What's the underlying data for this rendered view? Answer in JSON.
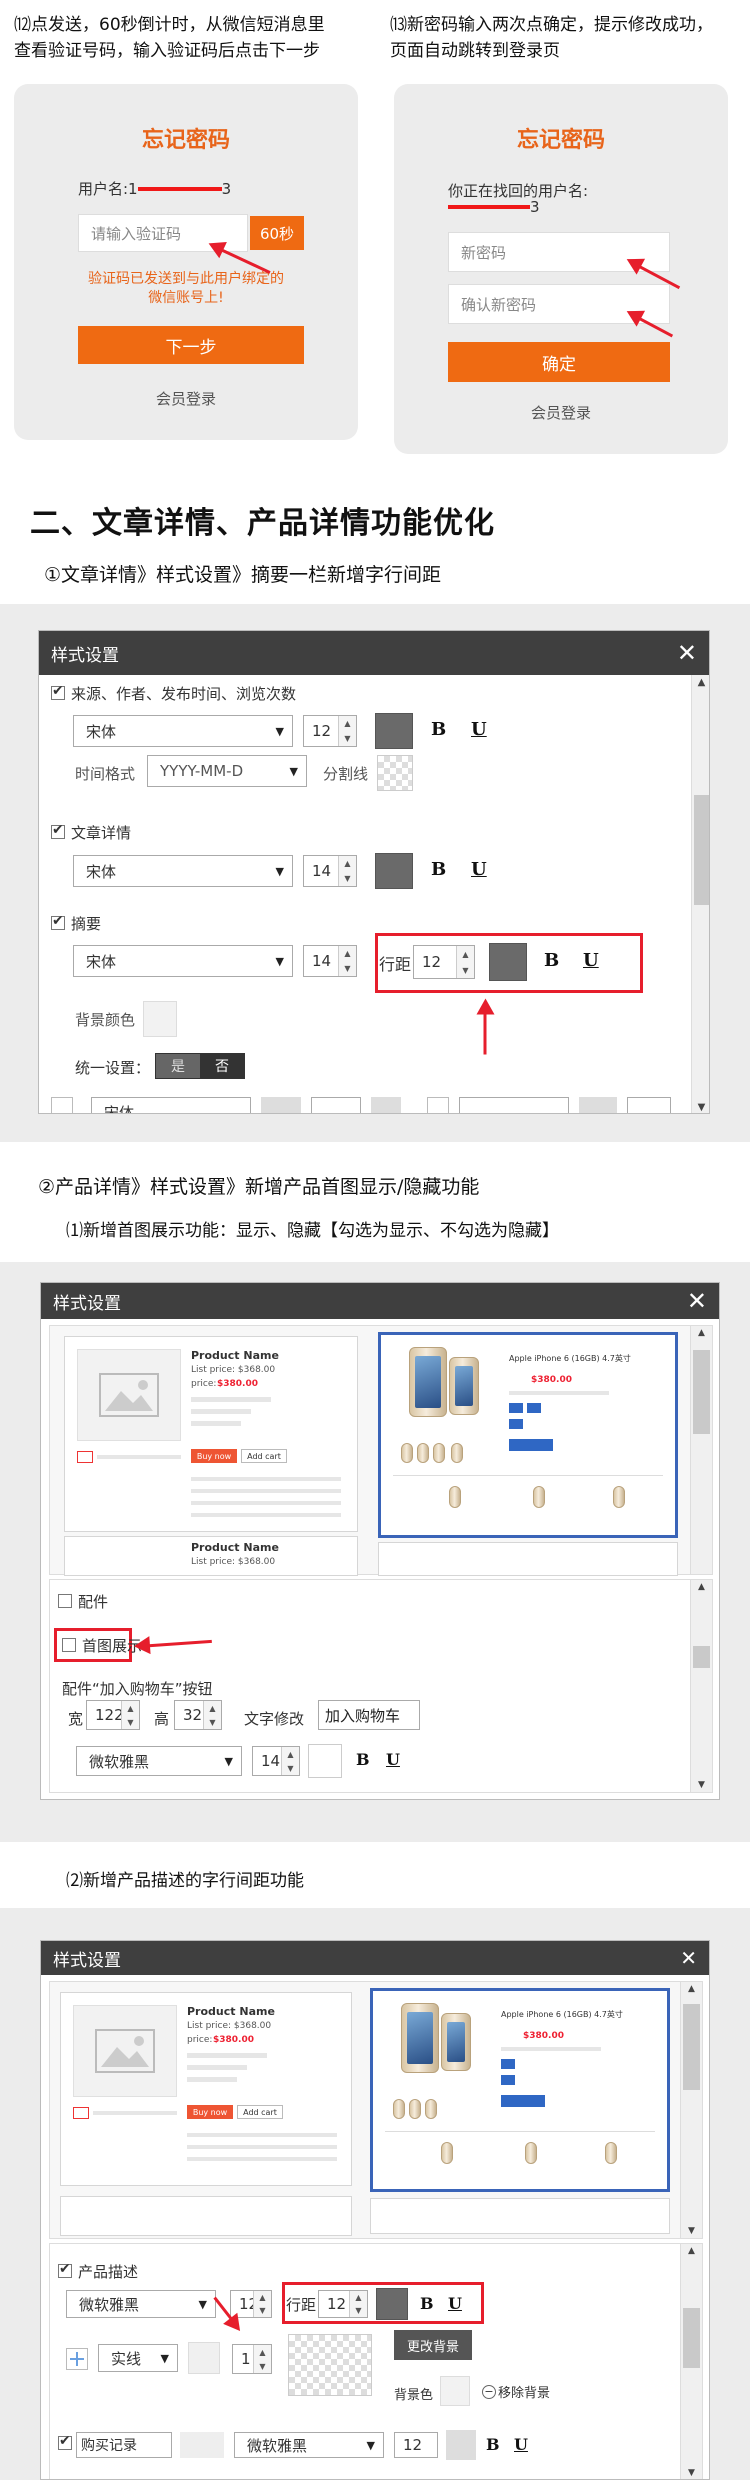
{
  "steps": {
    "step12": {
      "line1": "⑿点发送，60秒倒计时，从微信短消息里",
      "line2": "查看验证号码，输入验证码后点击下一步"
    },
    "step13": {
      "line1": "⒀新密码输入两次点确定，提示修改成功，",
      "line2": "页面自动跳转到登录页"
    }
  },
  "card1": {
    "title": "忘记密码",
    "username_label": "用户名:1",
    "username_suffix": "3",
    "code_placeholder": "请输入验证码",
    "countdown_button": "60秒",
    "notice_line1": "验证码已发送到与此用户绑定的",
    "notice_line2": "微信账号上!",
    "next_button": "下一步",
    "member_login": "会员登录"
  },
  "card2": {
    "title": "忘记密码",
    "found_label": "你正在找回的用户名:",
    "username_suffix": "3",
    "new_password_placeholder": "新密码",
    "confirm_placeholder": "确认新密码",
    "confirm_button": "确定",
    "member_login": "会员登录"
  },
  "section2": {
    "title": "二、文章详情、产品详情功能优化",
    "sub1": "①文章详情》样式设置》摘要一栏新增字行间距",
    "sub2": "②产品详情》样式设置》新增产品首图显示/隐藏功能",
    "sub2a": "⑴新增首图展示功能：显示、隐藏【勾选为显示、不勾选为隐藏】",
    "sub2b": "⑵新增产品描述的字行间距功能"
  },
  "dialog1": {
    "title": "样式设置",
    "close": "✕",
    "row1_label": "来源、作者、发布时间、浏览次数",
    "font": "宋体",
    "size12": "12",
    "size14": "14",
    "bold": "B",
    "underline": "U",
    "time_format_label": "时间格式",
    "time_format_value": "YYYY-MM-D",
    "divider_label": "分割线",
    "article_label": "文章详情",
    "summary_label": "摘要",
    "line_spacing_label": "行距",
    "line_spacing_value": "12",
    "bg_color_label": "背景颜色",
    "unified_label": "统一设置：",
    "yes": "是",
    "no": "否",
    "cut_font": "宋体"
  },
  "dialog2": {
    "title": "样式设置",
    "close": "✕",
    "product_name": "Product Name",
    "list_price": "List price: $368.00",
    "price_label": "price:",
    "price_value": "$380.00",
    "buy_now": "Buy now",
    "add_cart": "Add cart",
    "product_title_right": "Apple iPhone 6 (16GB) 4.7英寸",
    "peijian_label": "配件",
    "first_image_label": "首图展示",
    "cart_button_label": "配件“加入购物车”按钮",
    "width_label": "宽",
    "width_value": "122",
    "height_label": "高",
    "height_value": "32",
    "text_edit_label": "文字修改",
    "text_edit_value": "加入购物车",
    "font": "微软雅黑",
    "size": "14",
    "bold": "B",
    "underline": "U"
  },
  "dialog3": {
    "title": "样式设置",
    "close": "✕",
    "product_name": "Product Name",
    "list_price": "List price: $368.00",
    "price_label": "price:",
    "price_value": "$380.00",
    "buy_now": "Buy now",
    "add_cart": "Add cart",
    "product_title_right": "Apple iPhone 6 (16GB) 4.7英寸",
    "desc_label": "产品描述",
    "font": "微软雅黑",
    "size": "12",
    "line_spacing_label": "行距",
    "line_spacing_value": "12",
    "bold": "B",
    "underline": "U",
    "border_style": "实线",
    "border_width": "1",
    "change_bg_button": "更改背景",
    "bg_color_label": "背景色",
    "remove_bg": "移除背景",
    "cut_label": "购买记录",
    "cut_font": "微软雅黑",
    "cut_size": "12"
  },
  "colors": {
    "accent": "#ef6a12",
    "title_orange": "#e8641a",
    "annotation_red": "#e61e2c",
    "dialog_header": "#3f3f3f",
    "selected_blue": "#3a64b8"
  }
}
